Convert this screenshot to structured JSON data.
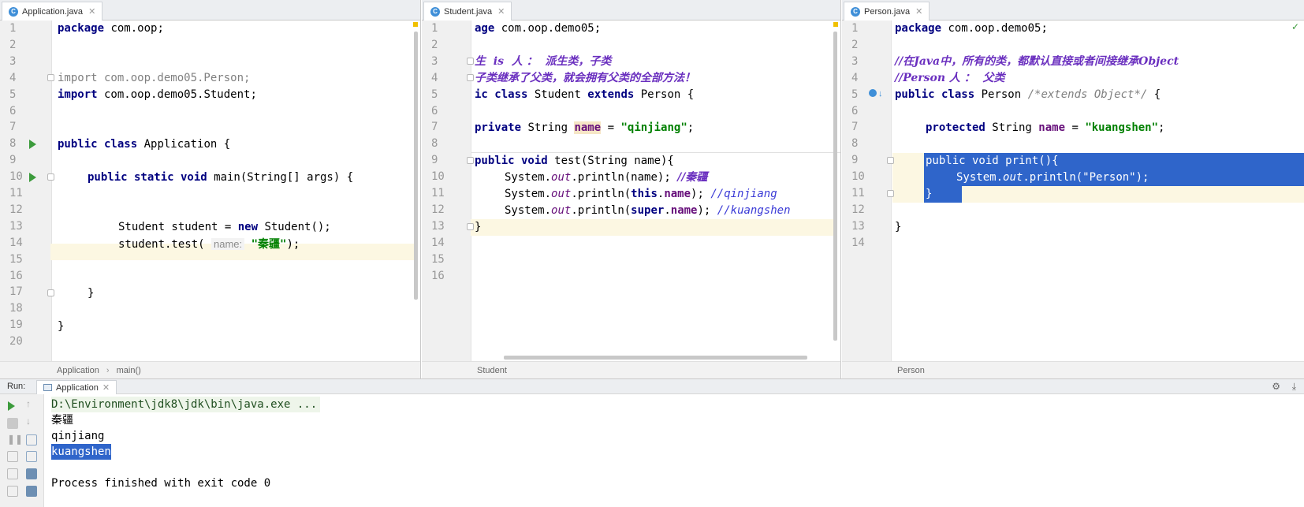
{
  "tabs": {
    "application": "Application.java",
    "student": "Student.java",
    "person": "Person.java"
  },
  "application_code": {
    "line_numbers": [
      "1",
      "2",
      "3",
      "4",
      "5",
      "6",
      "7",
      "8",
      "9",
      "10",
      "11",
      "12",
      "13",
      "14",
      "15",
      "16",
      "17",
      "18",
      "19",
      "20"
    ],
    "l1_kw": "package",
    "l1_rest": " com.oop;",
    "l4": "import com.oop.demo05.Person;",
    "l5_kw": "import",
    "l5_rest": " com.oop.demo05.Student;",
    "l8_kw": "public class",
    "l8_rest": " Application {",
    "l10_kw": "public static void",
    "l10_rest": " main(String[] args) {",
    "l13_a": "Student student = ",
    "l13_kw": "new",
    "l13_b": " Student();",
    "l14_a": "student.test( ",
    "l14_hint": "name:",
    "l14_str": "\"秦疆\"",
    "l14_b": ");",
    "l17": "}",
    "l19": "}"
  },
  "student_code": {
    "line_numbers": [
      "1",
      "2",
      "3",
      "4",
      "5",
      "6",
      "7",
      "8",
      "9",
      "10",
      "11",
      "12",
      "13",
      "14",
      "15",
      "16"
    ],
    "l1_kw": "age",
    "l1_rest": " com.oop.demo05;",
    "l3": "生  is  人 ：  派生类，子类",
    "l4": "子类继承了父类，就会拥有父类的全部方法！",
    "l5_kw": "ic class",
    "l5_mid": " Student ",
    "l5_kw2": "extends",
    "l5_rest": " Person {",
    "l7_kw": "private",
    "l7_a": " String ",
    "l7_fld": "name",
    "l7_b": " = ",
    "l7_str": "\"qinjiang\"",
    "l7_c": ";",
    "l9_kw": "public void",
    "l9_rest": " test(String name){",
    "l10_a": "System.",
    "l10_out": "out",
    "l10_b": ".println(name); ",
    "l10_cm": "//秦疆",
    "l11_a": "System.",
    "l11_out": "out",
    "l11_b": ".println(",
    "l11_kw": "this",
    "l11_c": ".",
    "l11_fld": "name",
    "l11_d": "); ",
    "l11_cm": "//qinjiang",
    "l12_a": "System.",
    "l12_out": "out",
    "l12_b": ".println(",
    "l12_kw": "super",
    "l12_c": ".",
    "l12_fld": "name",
    "l12_d": "); ",
    "l12_cm": "//kuangshen",
    "l13": "}"
  },
  "person_code": {
    "line_numbers": [
      "1",
      "2",
      "3",
      "4",
      "5",
      "6",
      "7",
      "8",
      "9",
      "10",
      "11",
      "12",
      "13",
      "14"
    ],
    "l1_kw": "package",
    "l1_rest": " com.oop.demo05;",
    "l3": "//在Java中，所有的类，都默认直接或者间接继承Object",
    "l4": "//Person 人 ：  父类",
    "l5_kw": "public class",
    "l5_mid": " Person ",
    "l5_cm": "/*extends Object*/",
    "l5_rest": " {",
    "l7_kw": "protected",
    "l7_a": " String ",
    "l7_fld": "name",
    "l7_b": " = ",
    "l7_str": "\"kuangshen\"",
    "l7_c": ";",
    "l9": "public void print(){",
    "l10_a": "System.",
    "l10_out": "out",
    "l10_b": ".println(\"Person\");",
    "l11": "}",
    "l13": "}"
  },
  "breadcrumbs": {
    "application": [
      "Application",
      "main()"
    ],
    "student": "Student",
    "person": "Person"
  },
  "run": {
    "label": "Run:",
    "tab": "Application",
    "output": [
      "D:\\Environment\\jdk8\\jdk\\bin\\java.exe ...",
      "秦疆",
      "qinjiang",
      "kuangshen",
      "",
      "Process finished with exit code 0"
    ]
  }
}
